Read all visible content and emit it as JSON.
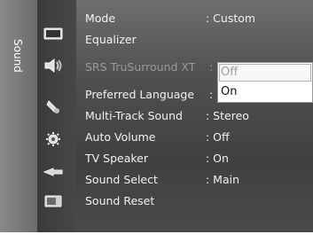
{
  "sidebar": {
    "label": "Sound"
  },
  "icons": [
    "picture-icon",
    "sound-icon",
    "channel-icon",
    "setup-icon",
    "input-icon",
    "application-icon"
  ],
  "menu": {
    "items": [
      {
        "label": "Mode",
        "value": ": Custom",
        "dim": false
      },
      {
        "label": "Equalizer",
        "value": "",
        "dim": false
      },
      {
        "label": "SRS TruSurround XT",
        "value": ":",
        "dim": true
      },
      {
        "label": "Preferred Language",
        "value": ":",
        "dim": false
      },
      {
        "label": "Multi-Track Sound",
        "value": ": Stereo",
        "dim": false
      },
      {
        "label": "Auto Volume",
        "value": ": Off",
        "dim": false
      },
      {
        "label": "TV Speaker",
        "value": ": On",
        "dim": false
      },
      {
        "label": "Sound Select",
        "value": ": Main",
        "dim": false
      },
      {
        "label": "Sound Reset",
        "value": "",
        "dim": false
      }
    ]
  },
  "popup": {
    "options": [
      "Off",
      "On"
    ],
    "selected": "Off"
  }
}
